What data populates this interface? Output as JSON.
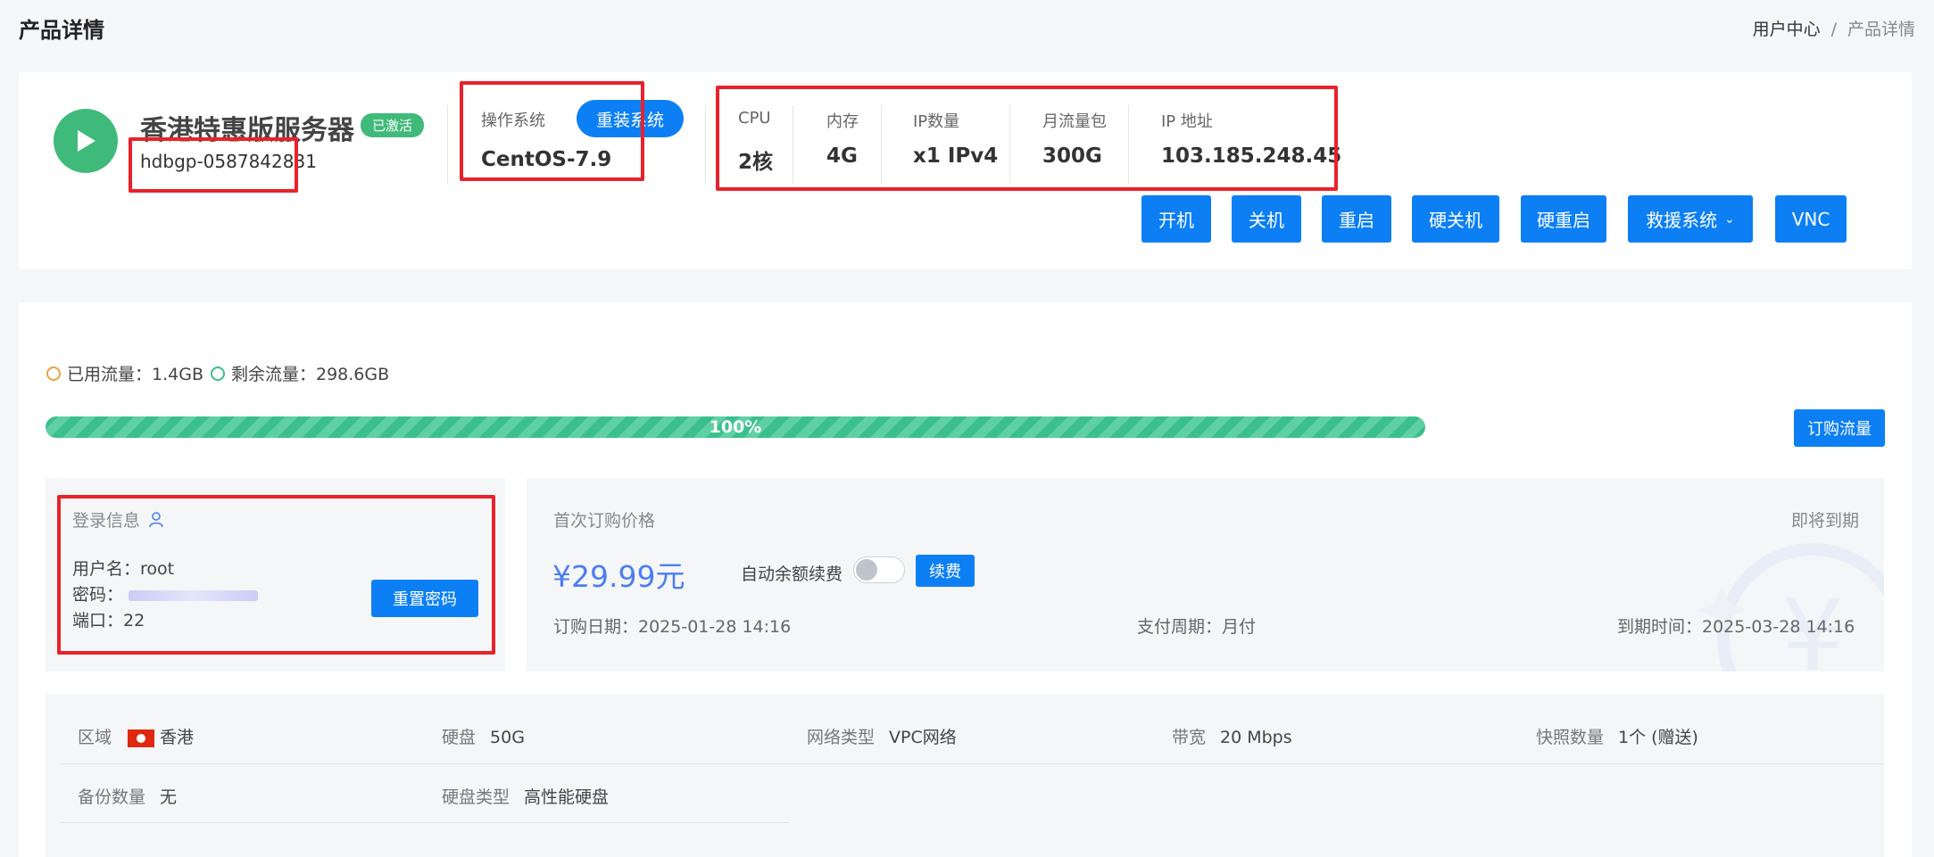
{
  "header": {
    "page_title": "产品详情",
    "breadcrumb": {
      "root": "用户中心",
      "separator": "/",
      "current": "产品详情"
    }
  },
  "product": {
    "icon": "play-icon",
    "name": "香港特惠版服务器",
    "status_badge": "已激活",
    "hostname": "hdbgp-0587842831"
  },
  "os": {
    "label": "操作系统",
    "value": "CentOS-7.9",
    "reinstall_label": "重装系统"
  },
  "specs_top": [
    {
      "label": "CPU",
      "value": "2核"
    },
    {
      "label": "内存",
      "value": "4G"
    },
    {
      "label": "IP数量",
      "value": "x1 IPv4"
    },
    {
      "label": "月流量包",
      "value": "300G"
    },
    {
      "label": "IP 地址",
      "value": "103.185.248.45"
    }
  ],
  "actions": {
    "power_on": "开机",
    "power_off": "关机",
    "reboot": "重启",
    "hard_off": "硬关机",
    "hard_reboot": "硬重启",
    "rescue": "救援系统",
    "vnc": "VNC"
  },
  "traffic": {
    "used_label": "已用流量：1.4GB",
    "remaining_label": "剩余流量：298.6GB",
    "progress_text": "100%",
    "progress_fraction": 1.0,
    "buy_label": "订购流量",
    "used_color": "#e9a23b",
    "remaining_color": "#3cbf8e"
  },
  "login": {
    "title": "登录信息",
    "icon": "user-icon",
    "username_label": "用户名：root",
    "password_label": "密码：",
    "port_label": "端口：22",
    "reset_label": "重置密码"
  },
  "billing": {
    "first_price_label": "首次订购价格",
    "price": "¥29.99元",
    "auto_renew_label": "自动余额续费",
    "renew_label": "续费",
    "expiring_label": "即将到期",
    "order_date": "订购日期：2025-01-28 14:16",
    "pay_cycle": "支付周期：月付",
    "expire_date": "到期时间：2025-03-28 14:16",
    "auto_renew_enabled": false
  },
  "details": [
    {
      "label": "区域",
      "value": "香港",
      "flag": "hk-flag-icon"
    },
    {
      "label": "硬盘",
      "value": "50G"
    },
    {
      "label": "网络类型",
      "value": "VPC网络"
    },
    {
      "label": "带宽",
      "value": "20 Mbps"
    },
    {
      "label": "快照数量",
      "value": "1个 (赠送)"
    },
    {
      "label": "备份数量",
      "value": "无"
    },
    {
      "label": "硬盘类型",
      "value": "高性能硬盘"
    }
  ],
  "colors": {
    "accent": "#0d7ff5",
    "success": "#3fba7a",
    "highlight_box": "#e8222a",
    "price": "#4a7ef2"
  }
}
